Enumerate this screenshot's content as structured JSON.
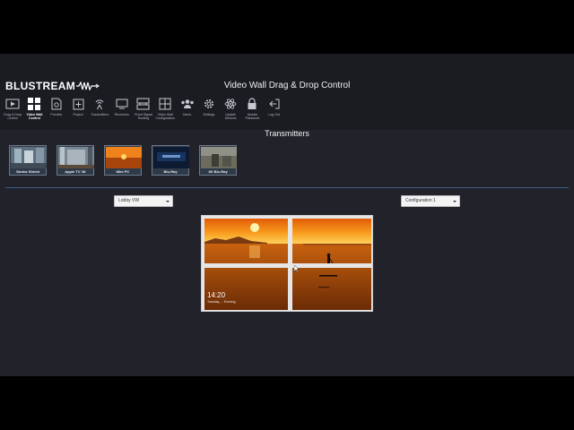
{
  "header": {
    "logo_text": "BLUSTREAM",
    "title": "Video Wall Drag & Drop Control"
  },
  "nav": [
    {
      "label": "Drag & Drop\nControl",
      "icon": "play-screen-icon",
      "active": false
    },
    {
      "label": "Video Wall\nControl",
      "icon": "video-wall-grid-icon",
      "active": true
    },
    {
      "label": "Preview",
      "icon": "preview-doc-icon",
      "active": false
    },
    {
      "label": "Project",
      "icon": "project-plus-icon",
      "active": false
    },
    {
      "label": "Transmitters",
      "icon": "transmitter-broadcast-icon",
      "active": false
    },
    {
      "label": "Receivers",
      "icon": "receiver-monitor-icon",
      "active": false
    },
    {
      "label": "Fixed Signal\nRouting",
      "icon": "signal-routing-icon",
      "active": false
    },
    {
      "label": "Video Wall\nConfiguration",
      "icon": "wall-config-icon",
      "active": false
    },
    {
      "label": "Users",
      "icon": "users-icon",
      "active": false
    },
    {
      "label": "Settings",
      "icon": "gear-icon",
      "active": false
    },
    {
      "label": "Update\nDevices",
      "icon": "atom-update-icon",
      "active": false
    },
    {
      "label": "Update\nPassword",
      "icon": "lock-icon",
      "active": false
    },
    {
      "label": "Log Out",
      "icon": "logout-icon",
      "active": false
    }
  ],
  "transmitters": {
    "title": "Transmitters",
    "items": [
      {
        "name": "Strobe Shield"
      },
      {
        "name": "Apple TV 4K"
      },
      {
        "name": "Mini PC"
      },
      {
        "name": "Blu-Ray"
      },
      {
        "name": "4K Blu-Ray"
      }
    ]
  },
  "wall_select": {
    "value": "Lobby VW"
  },
  "config_select": {
    "value": "Configuration 1"
  },
  "wall_preview": {
    "clock": "14:20",
    "date": "Tuesday, ...  Evening"
  },
  "colors": {
    "app_bg": "#21222a",
    "header_bg": "#1b1c22",
    "divider": "#3d5b86",
    "tile_border": "#6c7a8a"
  }
}
